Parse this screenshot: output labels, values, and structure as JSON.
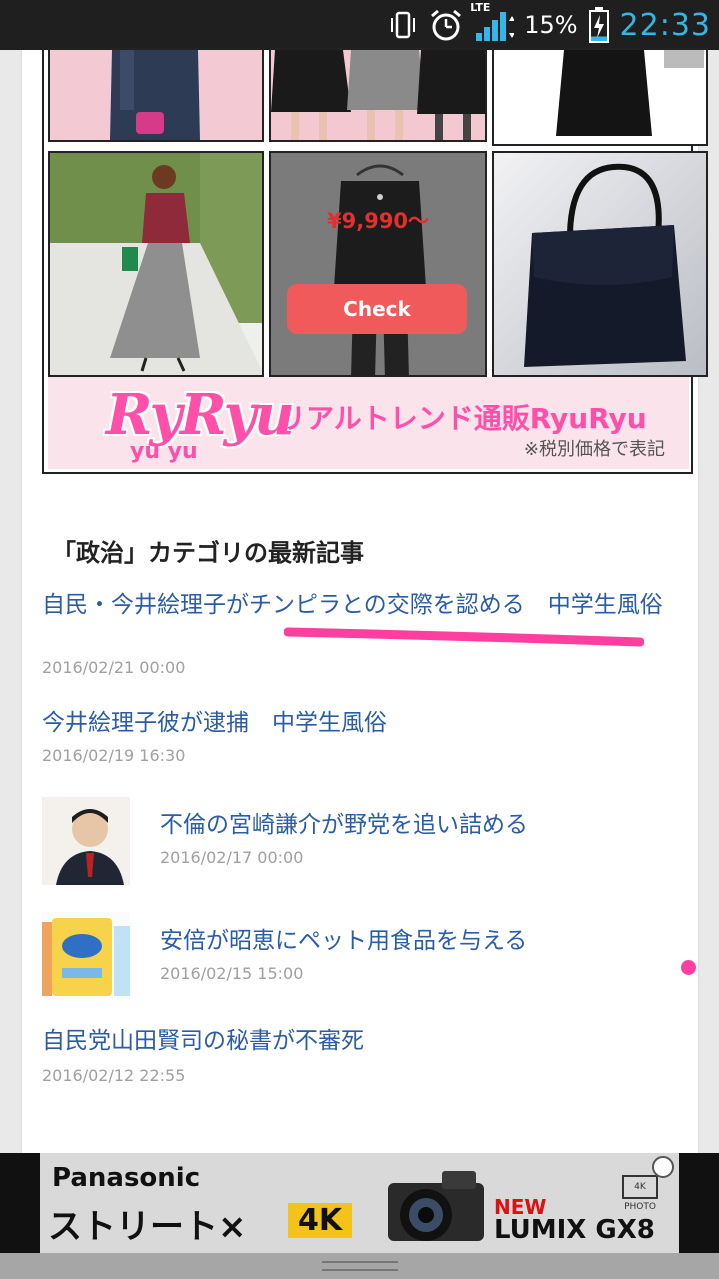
{
  "status_bar": {
    "network": "LTE",
    "battery_percent": "15%",
    "battery_level": 0.15,
    "time": "22:33",
    "time_color": "#35b6e6",
    "icons": [
      "vibrate-icon",
      "alarm-icon",
      "signal-icon",
      "battery-charging-icon"
    ]
  },
  "ad_grid": {
    "price": "¥9,990～",
    "check_label": "Check",
    "check_color": "#f05a5a",
    "banner": {
      "logo": "RyRyu",
      "logo_sub": "yu yu",
      "title": "リアルトレンド通販RyuRyu",
      "note": "※税別価格で表記",
      "color": "#ff4fa8"
    }
  },
  "section": {
    "title": "「政治」カテゴリの最新記事"
  },
  "articles": [
    {
      "title": "自民・今井絵理子がチンピラとの交際を認める　中学生風俗",
      "date": "2016/02/21 00:00"
    },
    {
      "title": "今井絵理子彼が逮捕　中学生風俗",
      "date": "2016/02/19 16:30"
    },
    {
      "title": "不倫の宮崎謙介が野党を追い詰める",
      "date": "2016/02/17 00:00"
    },
    {
      "title": "安倍が昭恵にペット用食品を与える",
      "date": "2016/02/15 15:00"
    },
    {
      "title": "自民党山田賢司の秘書が不審死",
      "date": "2016/02/12 22:55"
    }
  ],
  "link_color": "#2a5da6",
  "highlight_color": "#ff3fa0",
  "bottom_ad": {
    "brand": "Panasonic",
    "tagline": "ストリート×",
    "badge": "4K",
    "new_label": "NEW",
    "model": "LUMIX GX8",
    "photo_label": "4K PHOTO"
  }
}
